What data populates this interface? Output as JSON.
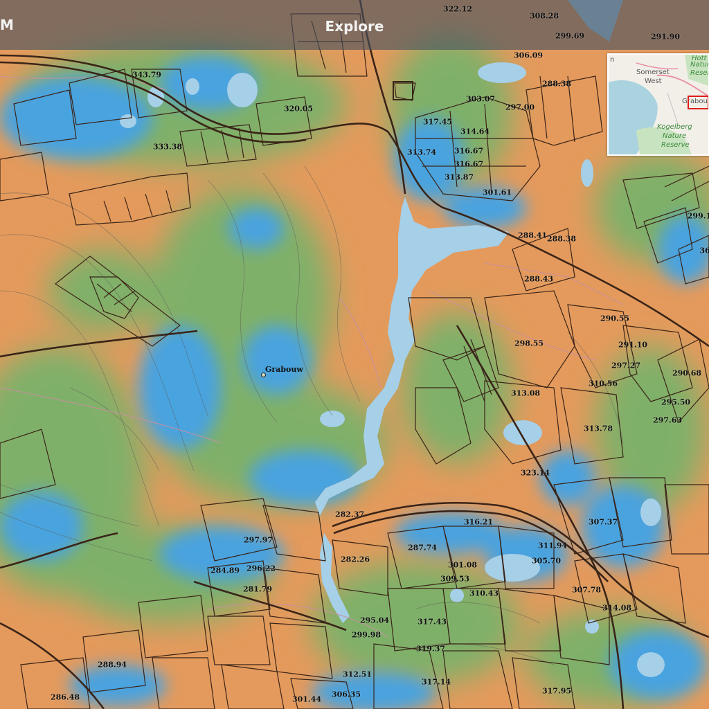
{
  "header": {
    "left_text": "M",
    "title": "Explore"
  },
  "place": {
    "name": "Grabouw"
  },
  "elevation_labels": [
    "322.12",
    "308.28",
    "299.69",
    "291.90",
    "343.79",
    "306.09",
    "288.38",
    "320.05",
    "303.07",
    "297.00",
    "317.45",
    "314.64",
    "333.38",
    "313.74",
    "316.67",
    "316.67",
    "313.87",
    "301.61",
    "299.1",
    "288.41",
    "288.38",
    "36",
    "288.43",
    "290.55",
    "291.10",
    "298.55",
    "297.27",
    "310.56",
    "290.68",
    "313.08",
    "295.50",
    "297.63",
    "313.78",
    "323.14",
    "282.37",
    "316.21",
    "307.37",
    "297.97",
    "287.74",
    "311.94",
    "282.26",
    "305.70",
    "284.89",
    "296.22",
    "301.08",
    "309.53",
    "281.79",
    "310.43",
    "307.78",
    "314.08",
    "295.04",
    "317.43",
    "299.98",
    "319.37",
    "288.94",
    "312.51",
    "317.14",
    "286.48",
    "306.35",
    "301.44",
    "317.95"
  ],
  "inset_map": {
    "labels": {
      "n": "n",
      "somerset": "Somerset",
      "west": "West",
      "hott": "Hott",
      "natur": "Natur",
      "reserv": "Reserv",
      "grabou": "Grabou",
      "kogelberg": "Kogelberg",
      "nature": "Nature",
      "reserve": "Reserve"
    }
  },
  "colors": {
    "terrain_orange": "#e49a5c",
    "terrain_green": "#7fb069",
    "terrain_blue": "#4aa3df",
    "water": "#a6cfe8",
    "boundary": "#3a2418",
    "roads": "#c88fa0",
    "header_bg": "#46505f",
    "inset_box": "#e01b1b"
  }
}
